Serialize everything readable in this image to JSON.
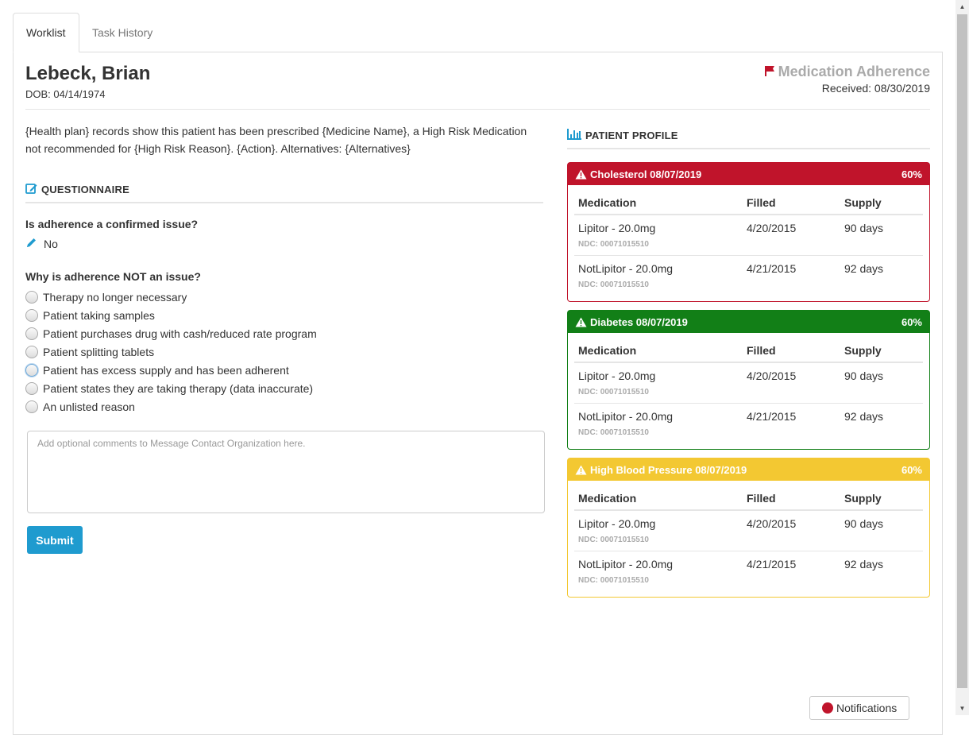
{
  "tabs": [
    {
      "label": "Worklist",
      "active": true
    },
    {
      "label": "Task History",
      "active": false
    }
  ],
  "patient": {
    "name": "Lebeck, Brian",
    "dob": "DOB: 04/14/1974"
  },
  "task": {
    "type": "Medication Adherence",
    "received": "Received: 08/30/2019",
    "flag_color": "#c0142b"
  },
  "message": "{Health plan} records show this patient has been prescribed {Medicine Name}, a High Risk Medication not recommended for {High Risk Reason}. {Action}. Alternatives: {Alternatives}",
  "questionnaire": {
    "heading": "QUESTIONNAIRE",
    "q1": {
      "text": "Is adherence a confirmed issue?",
      "answer": "No"
    },
    "q2": {
      "text": "Why is adherence NOT an issue?",
      "options": [
        "Therapy no longer necessary",
        "Patient taking samples",
        "Patient purchases drug with cash/reduced rate program",
        "Patient splitting tablets",
        "Patient has excess supply and has been adherent",
        "Patient states they are taking therapy (data inaccurate)",
        "An unlisted reason"
      ]
    },
    "comments_placeholder": "Add optional comments to Message Contact Organization here.",
    "submit_label": "Submit"
  },
  "profile": {
    "heading": "PATIENT PROFILE",
    "columns": {
      "medication": "Medication",
      "filled": "Filled",
      "supply": "Supply"
    },
    "cards": [
      {
        "title": "Cholesterol 08/07/2019",
        "percent": "60%",
        "color": "#c0142b",
        "icon": "warning-icon",
        "rows": [
          {
            "med": "Lipitor - 20.0mg",
            "ndc": "NDC: 00071015510",
            "filled": "4/20/2015",
            "supply": "90 days"
          },
          {
            "med": "NotLipitor - 20.0mg",
            "ndc": "NDC: 00071015510",
            "filled": "4/21/2015",
            "supply": "92 days"
          }
        ]
      },
      {
        "title": "Diabetes 08/07/2019",
        "percent": "60%",
        "color": "#127f17",
        "icon": "warning-icon",
        "rows": [
          {
            "med": "Lipitor - 20.0mg",
            "ndc": "NDC: 00071015510",
            "filled": "4/20/2015",
            "supply": "90 days"
          },
          {
            "med": "NotLipitor - 20.0mg",
            "ndc": "NDC: 00071015510",
            "filled": "4/21/2015",
            "supply": "92 days"
          }
        ]
      },
      {
        "title": "High Blood Pressure 08/07/2019",
        "percent": "60%",
        "color": "#f3c832",
        "icon": "warning-icon",
        "rows": [
          {
            "med": "Lipitor - 20.0mg",
            "ndc": "NDC: 00071015510",
            "filled": "4/20/2015",
            "supply": "90 days"
          },
          {
            "med": "NotLipitor - 20.0mg",
            "ndc": "NDC: 00071015510",
            "filled": "4/21/2015",
            "supply": "92 days"
          }
        ]
      }
    ]
  },
  "notifications": {
    "label": "Notifications",
    "dot_color": "#c0142b"
  }
}
